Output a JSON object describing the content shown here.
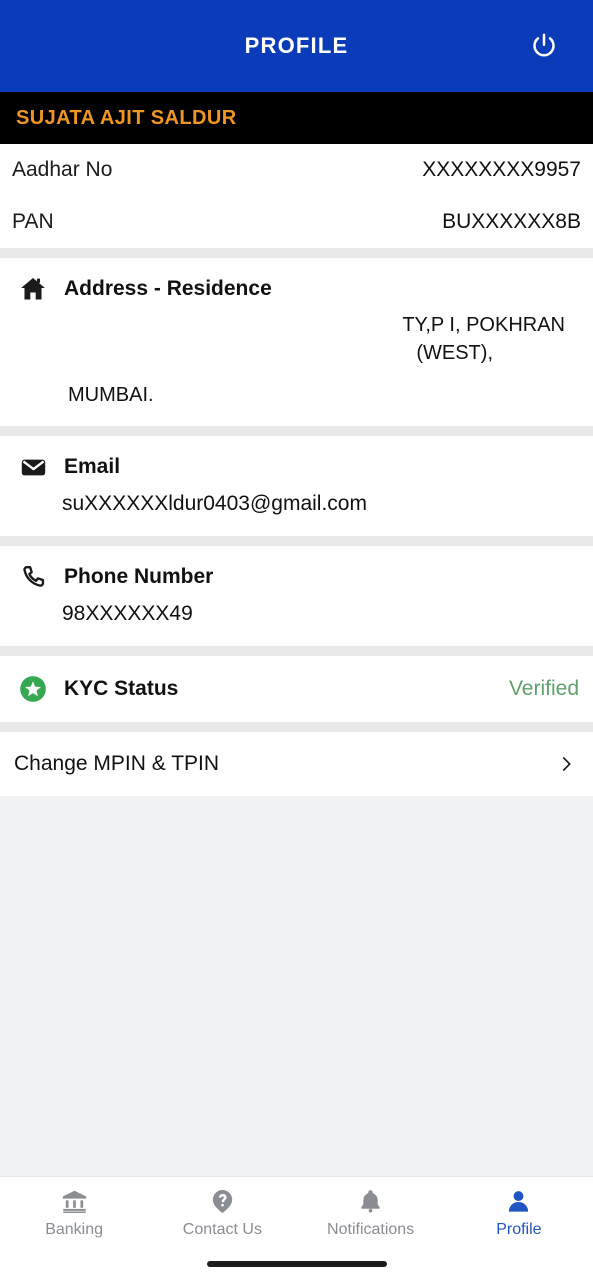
{
  "appbar": {
    "title": "PROFILE",
    "power_icon": "power-icon",
    "bg_color": "#0a3bb8"
  },
  "name_banner": {
    "name": "SUJATA AJIT SALDUR",
    "text_color": "#ef9622",
    "bg_color": "#000000"
  },
  "identity": {
    "rows": [
      {
        "label": "Aadhar No",
        "value": "XXXXXXXX9957"
      },
      {
        "label": "PAN",
        "value": "BUXXXXXX8B"
      }
    ]
  },
  "address": {
    "icon": "home-icon",
    "title": "Address - Residence",
    "line1": "TY,P I, POKHRAN",
    "line2": "(WEST),",
    "line3": "MUMBAI."
  },
  "email": {
    "icon": "envelope-icon",
    "title": "Email",
    "value": "suXXXXXXldur0403@gmail.com"
  },
  "phone": {
    "icon": "phone-icon",
    "title": "Phone Number",
    "value": "98XXXXXX49"
  },
  "kyc": {
    "icon": "star-badge-icon",
    "title": "KYC Status",
    "status": "Verified",
    "status_color": "#5fa06b",
    "badge_color": "#36a852"
  },
  "mpin": {
    "label": "Change MPIN & TPIN",
    "chevron": "chevron-right-icon"
  },
  "bottom_nav": {
    "active_color": "#2255c4",
    "inactive_color": "#8a8d92",
    "tabs": [
      {
        "label": "Banking",
        "icon": "bank-icon",
        "active": false
      },
      {
        "label": "Contact Us",
        "icon": "help-pin-icon",
        "active": false
      },
      {
        "label": "Notifications",
        "icon": "bell-icon",
        "active": false
      },
      {
        "label": "Profile",
        "icon": "person-icon",
        "active": true
      }
    ]
  }
}
